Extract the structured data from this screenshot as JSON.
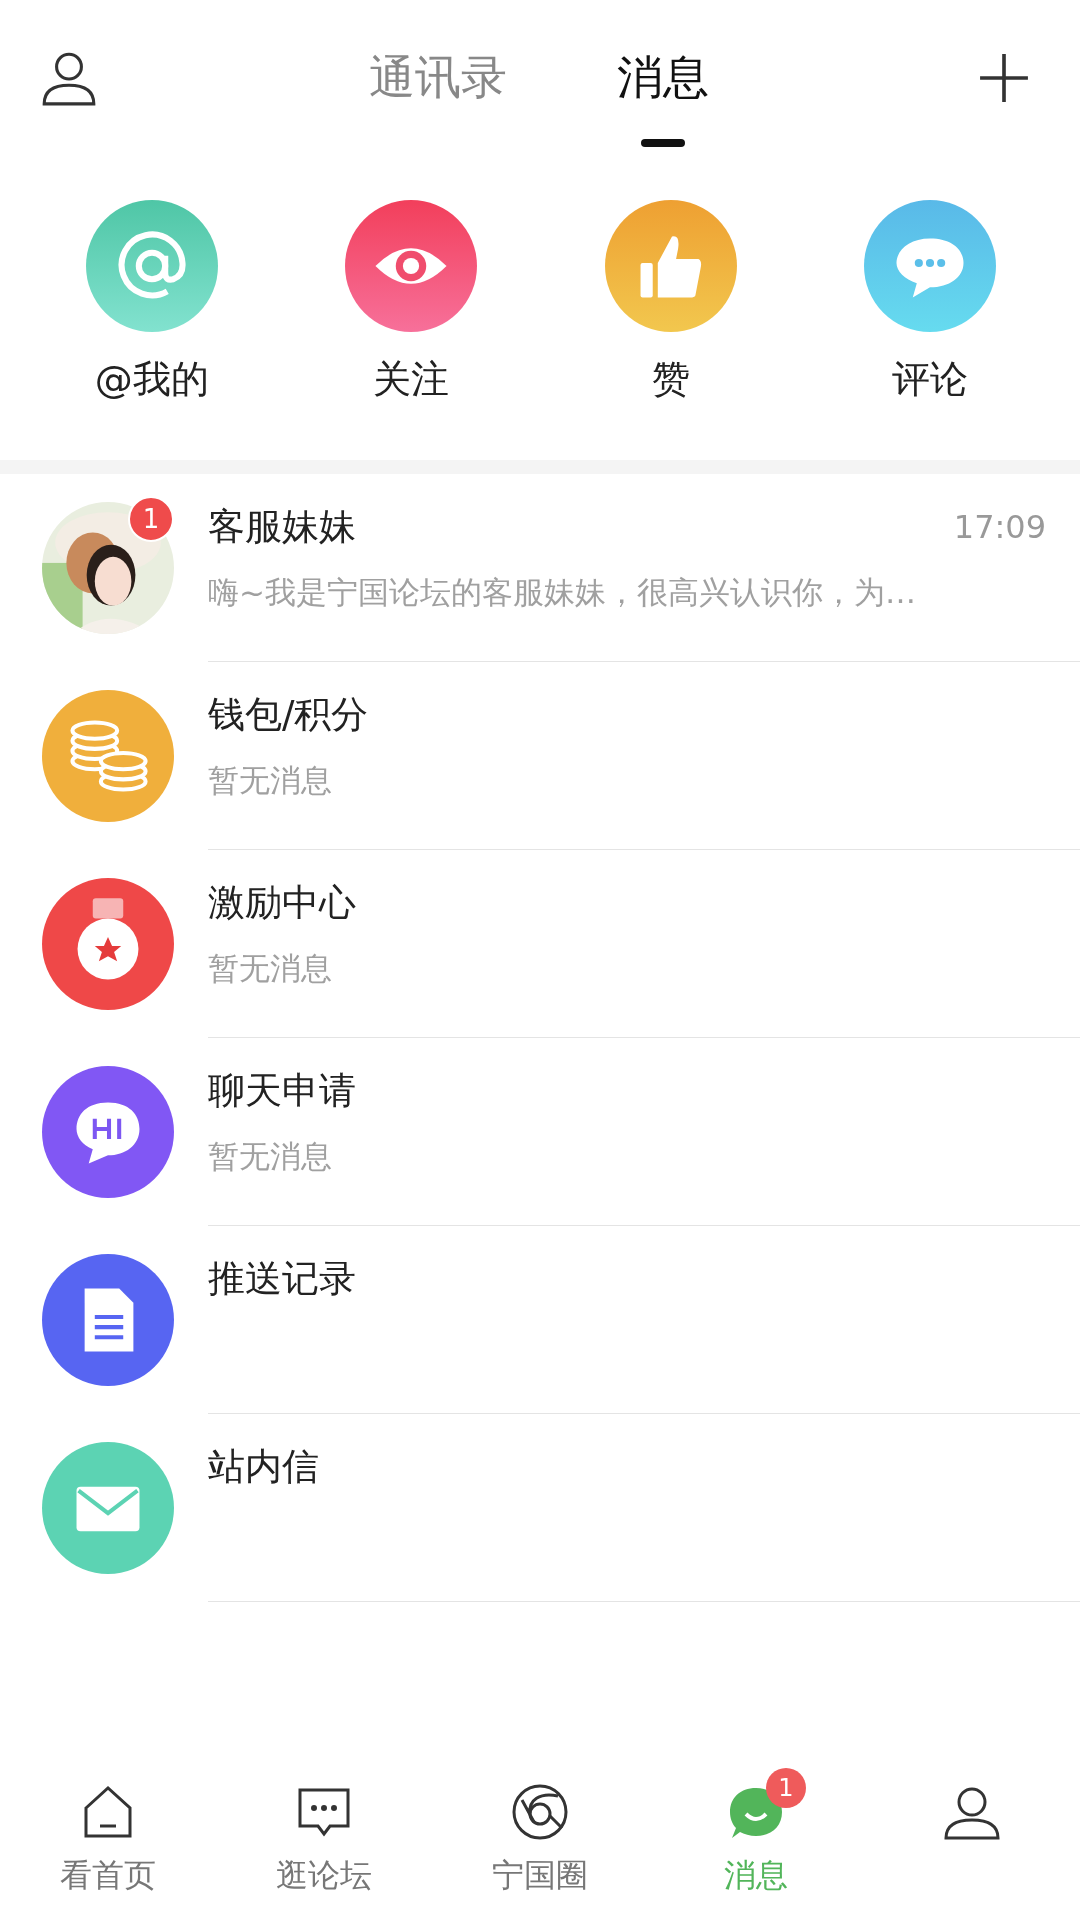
{
  "header": {
    "tabs": [
      {
        "label": "通讯录",
        "selected": false
      },
      {
        "label": "消息",
        "selected": true
      }
    ]
  },
  "shortcuts": [
    {
      "kind": "at",
      "label": "@我的"
    },
    {
      "kind": "eye",
      "label": "关注"
    },
    {
      "kind": "like",
      "label": "赞"
    },
    {
      "kind": "comment",
      "label": "评论"
    }
  ],
  "conversations": [
    {
      "kind": "avatar",
      "title": "客服妹妹",
      "time": "17:09",
      "preview": "嗨~我是宁国论坛的客服妹妹，很高兴认识你，为…",
      "badge": "1"
    },
    {
      "kind": "coins",
      "title": "钱包/积分",
      "preview": "暂无消息"
    },
    {
      "kind": "medal",
      "title": "激励中心",
      "preview": "暂无消息"
    },
    {
      "kind": "hi",
      "title": "聊天申请",
      "preview": "暂无消息"
    },
    {
      "kind": "document",
      "title": "推送记录"
    },
    {
      "kind": "mail",
      "title": "站内信"
    }
  ],
  "bottom_nav": [
    {
      "kind": "home",
      "label": "看首页",
      "selected": false
    },
    {
      "kind": "forum",
      "label": "逛论坛",
      "selected": false
    },
    {
      "kind": "circle",
      "label": "宁国圈",
      "selected": false
    },
    {
      "kind": "message",
      "label": "消息",
      "selected": true,
      "badge": "1"
    },
    {
      "kind": "profile",
      "selected": false
    }
  ]
}
